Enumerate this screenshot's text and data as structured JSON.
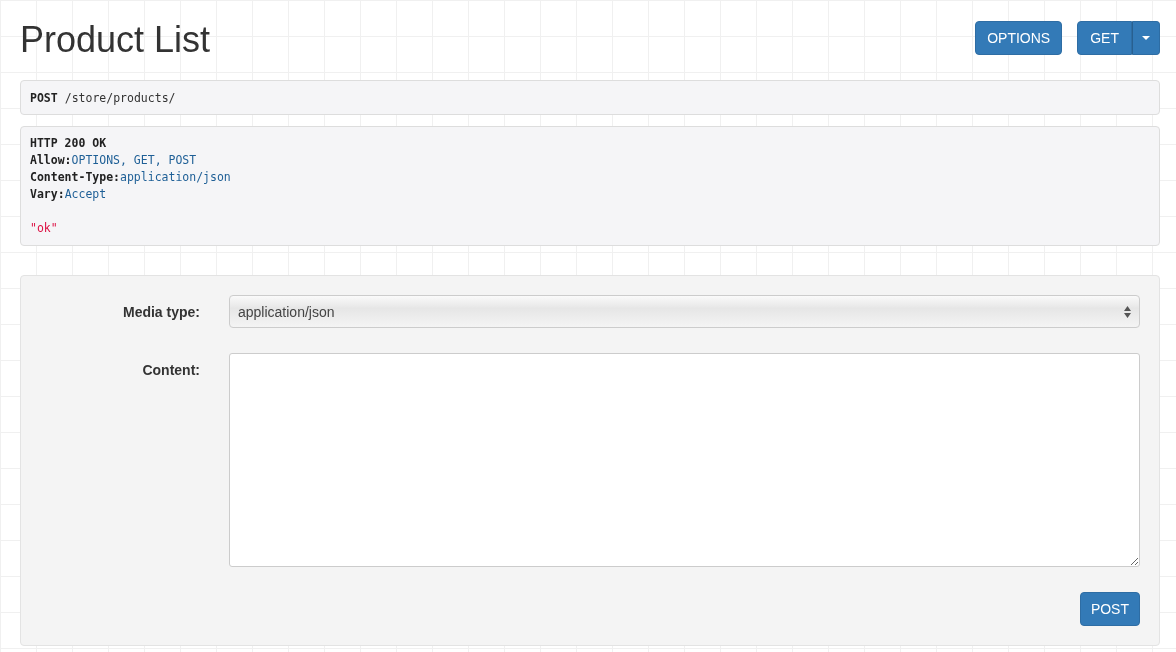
{
  "title": "Product List",
  "header_buttons": [
    {
      "label": "OPTIONS",
      "kind": "plain"
    },
    {
      "label": "GET",
      "kind": "split"
    }
  ],
  "request": {
    "method": "POST",
    "path": "/store/products/"
  },
  "response": {
    "status": "HTTP 200 OK",
    "headers": [
      {
        "name": "Allow:",
        "value": "OPTIONS, GET, POST"
      },
      {
        "name": "Content-Type:",
        "value": "application/json"
      },
      {
        "name": "Vary:",
        "value": "Accept"
      }
    ],
    "body": "\"ok\""
  },
  "form": {
    "media_type": {
      "label": "Media type:",
      "value": "application/json"
    },
    "content": {
      "label": "Content:"
    },
    "submit": "POST"
  }
}
